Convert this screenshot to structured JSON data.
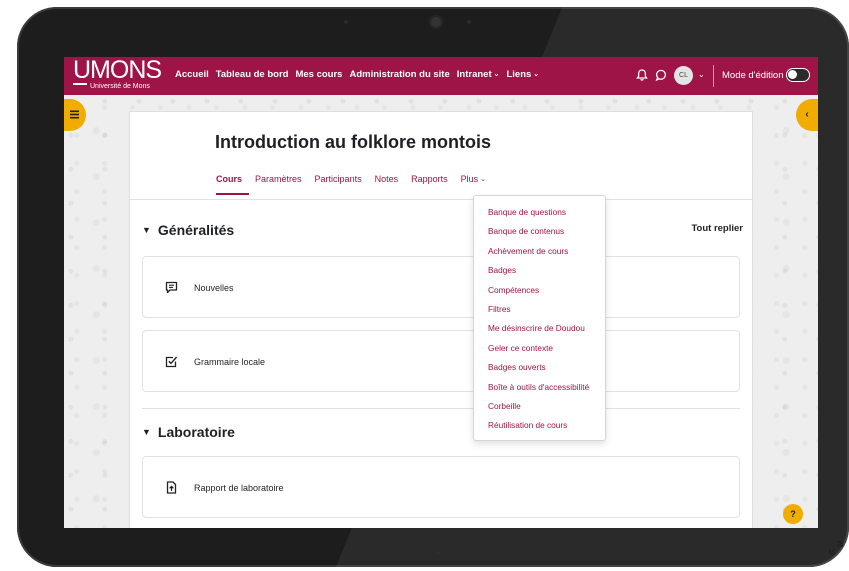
{
  "navbar": {
    "logo_main": "UMONS",
    "logo_sub": "Université de Mons",
    "links": [
      {
        "label": "Accueil"
      },
      {
        "label": "Tableau de bord"
      },
      {
        "label": "Mes cours"
      },
      {
        "label": "Administration du site"
      },
      {
        "label": "Intranet",
        "has_dropdown": true
      },
      {
        "label": "Liens",
        "has_dropdown": true
      }
    ],
    "avatar_initials": "CL",
    "edit_mode_label": "Mode d'édition",
    "edit_mode_on": false
  },
  "course": {
    "title": "Introduction au folklore montois",
    "tabs": [
      {
        "label": "Cours",
        "active": true
      },
      {
        "label": "Paramètres"
      },
      {
        "label": "Participants"
      },
      {
        "label": "Notes"
      },
      {
        "label": "Rapports"
      },
      {
        "label": "Plus",
        "has_dropdown": true
      }
    ],
    "collapse_all_label": "Tout replier",
    "sections": [
      {
        "title": "Généralités",
        "activities": [
          {
            "label": "Nouvelles",
            "icon": "forum-icon"
          },
          {
            "label": "Grammaire locale",
            "icon": "checkbox-icon"
          }
        ]
      },
      {
        "title": "Laboratoire",
        "activities": [
          {
            "label": "Rapport de laboratoire",
            "icon": "assignment-icon"
          }
        ]
      }
    ]
  },
  "more_menu": {
    "items": [
      "Banque de questions",
      "Banque de contenus",
      "Achèvement de cours",
      "Badges",
      "Compétences",
      "Filtres",
      "Me désinscrire de Doudou",
      "Geler ce contexte",
      "Badges ouverts",
      "Boîte à outils d'accessibilité",
      "Corbeille",
      "Réutilisation de cours"
    ]
  },
  "help_label": "?",
  "colors": {
    "brand": "#9e1446",
    "accent": "#f0ad00",
    "text": "#1d2125"
  }
}
